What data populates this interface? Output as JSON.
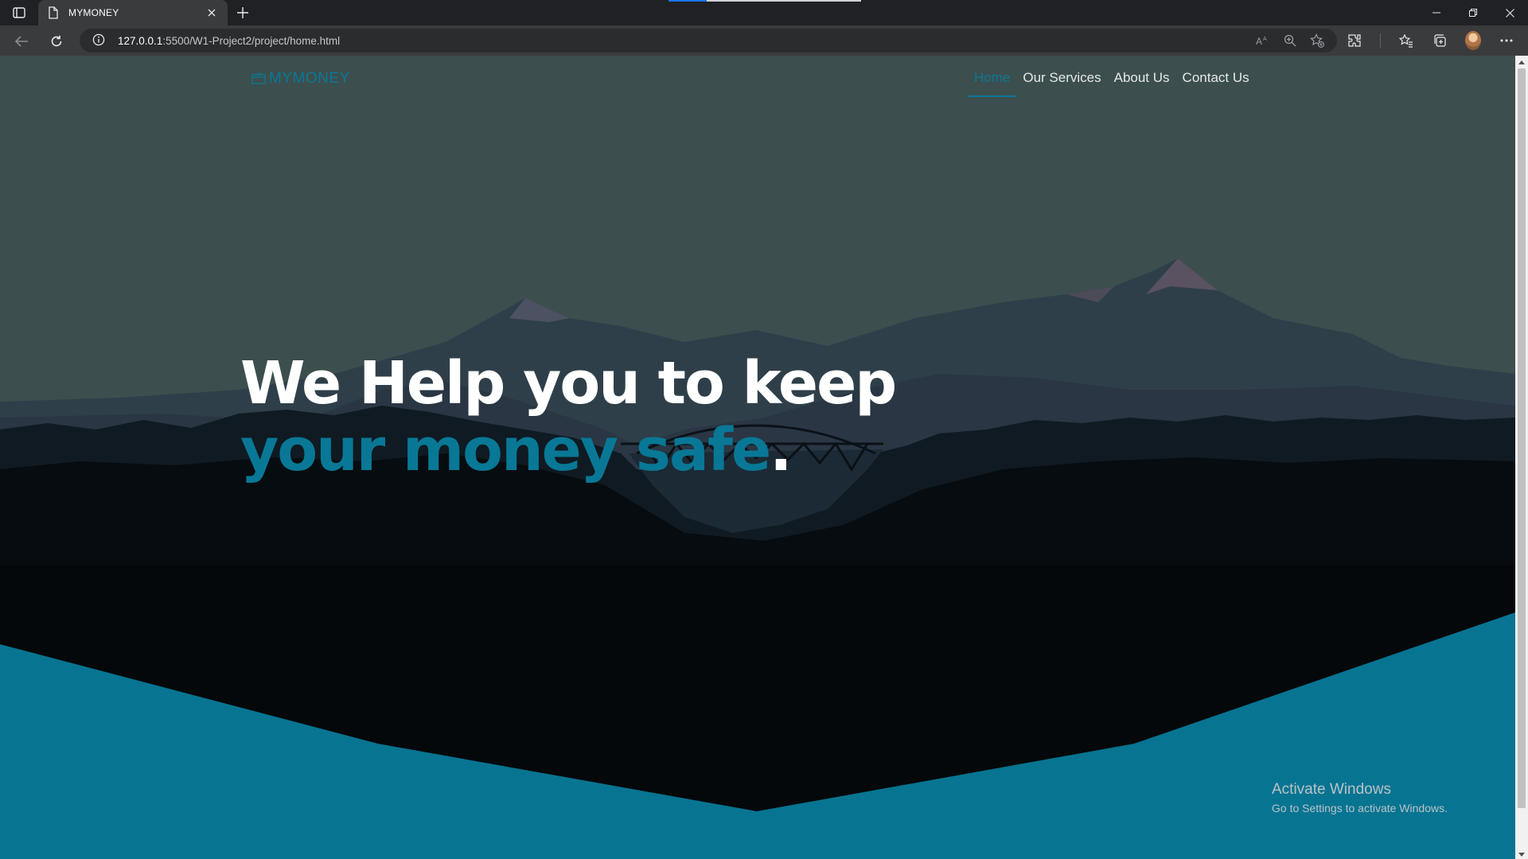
{
  "browser": {
    "tab_title": "MYMONEY",
    "url_host": "127.0.0.1",
    "url_path": ":5500/W1-Project2/project/home.html"
  },
  "site": {
    "logo_text": "MYMONEY",
    "menu": [
      {
        "label": "Home",
        "active": true
      },
      {
        "label": "Our Services",
        "active": false
      },
      {
        "label": "About Us",
        "active": false
      },
      {
        "label": "Contact Us",
        "active": false
      }
    ],
    "headline": {
      "part1": "We Help you to keep ",
      "highlight": "your money safe",
      "ending": "."
    }
  },
  "os_watermark": {
    "title": "Activate Windows",
    "subtitle": "Go to Settings to activate Windows."
  },
  "colors": {
    "accent": "#087896",
    "sky": "#3d4e4e",
    "dark_forest": "#05090c"
  }
}
